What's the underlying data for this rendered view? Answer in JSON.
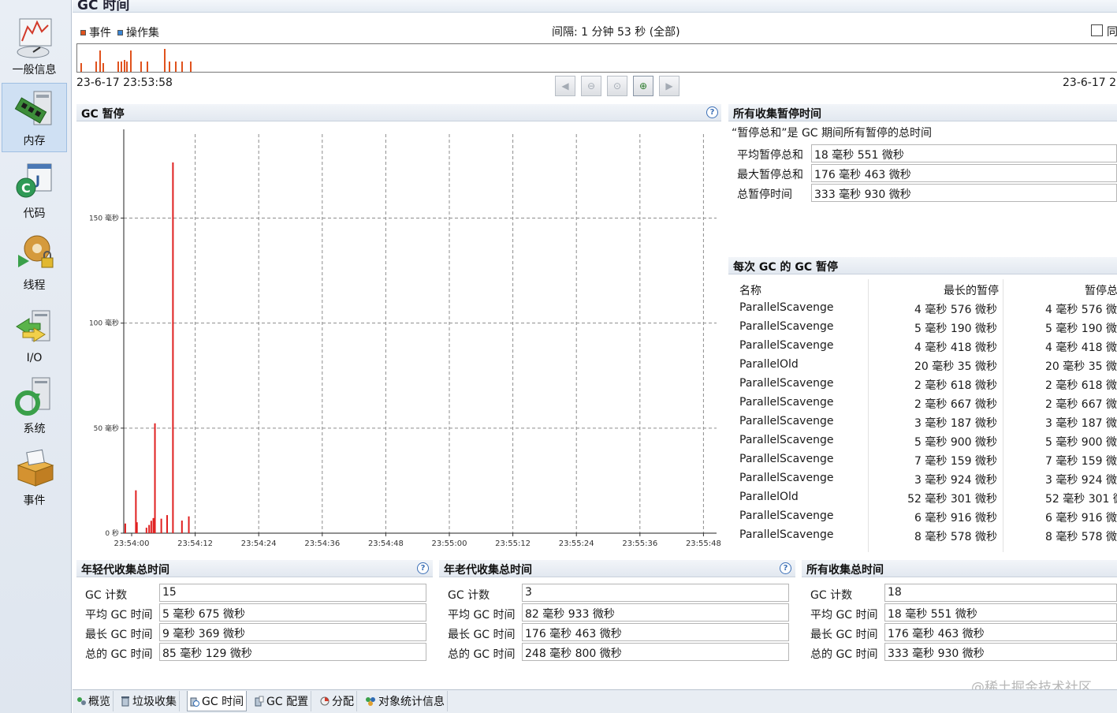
{
  "title": "GC 时间",
  "nav": {
    "items": [
      {
        "label": "一般信息",
        "icon": "dashboard-icon",
        "selected": false
      },
      {
        "label": "内存",
        "icon": "memory-chip-icon",
        "selected": true
      },
      {
        "label": "代码",
        "icon": "code-icon",
        "selected": false
      },
      {
        "label": "线程",
        "icon": "threads-gear-icon",
        "selected": false
      },
      {
        "label": "I/O",
        "icon": "io-arrows-icon",
        "selected": false
      },
      {
        "label": "系统",
        "icon": "system-icon",
        "selected": false
      },
      {
        "label": "事件",
        "icon": "events-box-icon",
        "selected": false
      }
    ]
  },
  "range_bar": {
    "legend_events": "事件",
    "legend_operations": "操作集",
    "interval": "间隔: 1 分钟 53 秒 (全部)",
    "sync_label": "同",
    "start_time": "23-6-17 23:53:58",
    "end_time": "23-6-17 2",
    "colors": {
      "events": "#e0521d",
      "operations": "#3a86d6"
    }
  },
  "gc_pause_panel": {
    "title": "GC 暂停",
    "chart_data": {
      "type": "bar",
      "y_unit": "毫秒",
      "ylim": [
        0,
        190
      ],
      "y_ticks": [
        {
          "value": 0,
          "label": "0 秒"
        },
        {
          "value": 50,
          "label": "50 毫秒"
        },
        {
          "value": 100,
          "label": "100 毫秒"
        },
        {
          "value": 150,
          "label": "150 毫秒"
        }
      ],
      "x_range_seconds": [
        0,
        115
      ],
      "x_ticks": [
        {
          "t": 0,
          "label": "23:54:00"
        },
        {
          "t": 12,
          "label": "23:54:12"
        },
        {
          "t": 24,
          "label": "23:54:24"
        },
        {
          "t": 36,
          "label": "23:54:36"
        },
        {
          "t": 48,
          "label": "23:54:48"
        },
        {
          "t": 60,
          "label": "23:55:00"
        },
        {
          "t": 72,
          "label": "23:55:12"
        },
        {
          "t": 84,
          "label": "23:55:24"
        },
        {
          "t": 96,
          "label": "23:55:36"
        },
        {
          "t": 108,
          "label": "23:55:48"
        }
      ],
      "grid": true,
      "color": "#e02020",
      "bars": [
        {
          "t": -1.2,
          "v": 4.6
        },
        {
          "t": 0.8,
          "v": 20.4
        },
        {
          "t": 1.0,
          "v": 5.2
        },
        {
          "t": 2.8,
          "v": 2.6
        },
        {
          "t": 3.3,
          "v": 3.9
        },
        {
          "t": 3.7,
          "v": 5.9
        },
        {
          "t": 4.1,
          "v": 7.2
        },
        {
          "t": 4.4,
          "v": 52.3
        },
        {
          "t": 5.6,
          "v": 6.9
        },
        {
          "t": 6.7,
          "v": 8.6
        },
        {
          "t": 7.8,
          "v": 176.5
        },
        {
          "t": 9.5,
          "v": 6.0
        },
        {
          "t": 10.8,
          "v": 8.0
        }
      ]
    }
  },
  "all_pauses": {
    "title": "所有收集暂停时间",
    "note": "“暂停总和”是 GC 期间所有暂停的总时间",
    "rows": [
      {
        "label": "平均暂停总和",
        "value": "18 毫秒 551 微秒"
      },
      {
        "label": "最大暂停总和",
        "value": "176 毫秒 463 微秒"
      },
      {
        "label": "总暂停时间",
        "value": "333 毫秒 930 微秒"
      }
    ]
  },
  "per_gc": {
    "title": "每次 GC 的 GC 暂停",
    "headers": [
      "名称",
      "最长的暂停",
      "暂停总"
    ],
    "rows": [
      [
        "ParallelScavenge",
        "4 毫秒 576 微秒",
        "4 毫秒 576 微"
      ],
      [
        "ParallelScavenge",
        "5 毫秒 190 微秒",
        "5 毫秒 190 微"
      ],
      [
        "ParallelScavenge",
        "4 毫秒 418 微秒",
        "4 毫秒 418 微"
      ],
      [
        "ParallelOld",
        "20 毫秒 35 微秒",
        "20 毫秒 35 微"
      ],
      [
        "ParallelScavenge",
        "2 毫秒 618 微秒",
        "2 毫秒 618 微"
      ],
      [
        "ParallelScavenge",
        "2 毫秒 667 微秒",
        "2 毫秒 667 微"
      ],
      [
        "ParallelScavenge",
        "3 毫秒 187 微秒",
        "3 毫秒 187 微"
      ],
      [
        "ParallelScavenge",
        "5 毫秒 900 微秒",
        "5 毫秒 900 微"
      ],
      [
        "ParallelScavenge",
        "7 毫秒 159 微秒",
        "7 毫秒 159 微"
      ],
      [
        "ParallelScavenge",
        "3 毫秒 924 微秒",
        "3 毫秒 924 微"
      ],
      [
        "ParallelOld",
        "52 毫秒 301 微秒",
        "52 毫秒 301 微"
      ],
      [
        "ParallelScavenge",
        "6 毫秒 916 微秒",
        "6 毫秒 916 微"
      ],
      [
        "ParallelScavenge",
        "8 毫秒 578 微秒",
        "8 毫秒 578 微"
      ]
    ]
  },
  "young_gen": {
    "title": "年轻代收集总时间",
    "rows": [
      {
        "label": "GC 计数",
        "value": "15"
      },
      {
        "label": "平均 GC 时间",
        "value": "5 毫秒 675 微秒"
      },
      {
        "label": "最长 GC 时间",
        "value": "9 毫秒 369 微秒"
      },
      {
        "label": "总的 GC 时间",
        "value": "85 毫秒 129 微秒"
      }
    ]
  },
  "old_gen": {
    "title": "年老代收集总时间",
    "rows": [
      {
        "label": "GC 计数",
        "value": "3"
      },
      {
        "label": "平均 GC 时间",
        "value": "82 毫秒 933 微秒"
      },
      {
        "label": "最长 GC 时间",
        "value": "176 毫秒 463 微秒"
      },
      {
        "label": "总的 GC 时间",
        "value": "248 毫秒 800 微秒"
      }
    ]
  },
  "all_gen": {
    "title": "所有收集总时间",
    "rows": [
      {
        "label": "GC 计数",
        "value": "18"
      },
      {
        "label": "平均 GC 时间",
        "value": "18 毫秒 551 微秒"
      },
      {
        "label": "最长 GC 时间",
        "value": "176 毫秒 463 微秒"
      },
      {
        "label": "总的 GC 时间",
        "value": "333 毫秒 930 微秒"
      }
    ]
  },
  "tabs": [
    {
      "label": "概览",
      "icon": "overview-icon",
      "selected": false
    },
    {
      "label": "垃圾收集",
      "icon": "trash-icon",
      "selected": false
    },
    {
      "label": "GC 时间",
      "icon": "gc-time-icon",
      "selected": true
    },
    {
      "label": "GC 配置",
      "icon": "gc-config-icon",
      "selected": false
    },
    {
      "label": "分配",
      "icon": "allocation-pie-icon",
      "selected": false
    },
    {
      "label": "对象统计信息",
      "icon": "object-stats-icon",
      "selected": false
    }
  ],
  "watermark": "@稀土掘金技术社区"
}
